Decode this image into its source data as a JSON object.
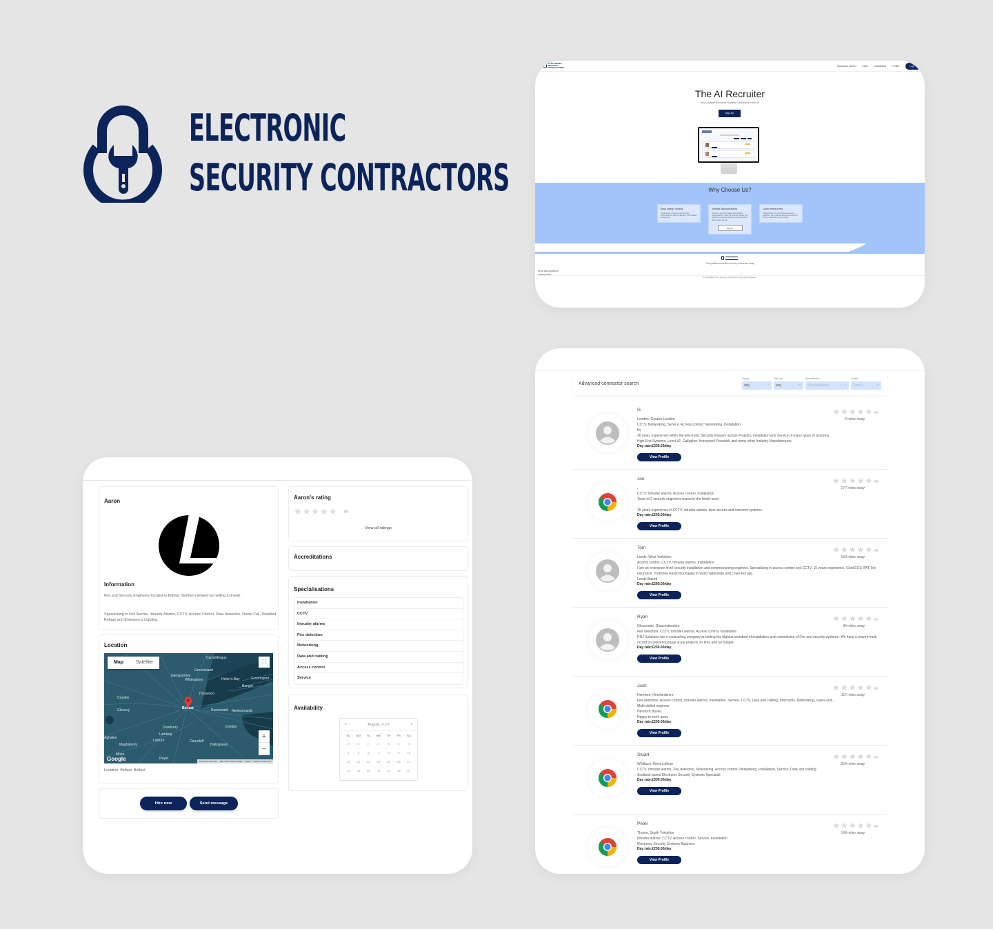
{
  "brand": {
    "line1": "ELECTRONIC",
    "line2": "SECURITY CONTRACTORS",
    "color": "#0c2459"
  },
  "landing": {
    "nav": {
      "logo_text": "ELECTRONIC SECURITY CONTRACTORS",
      "links": [
        "Contractor search",
        "Inbox",
        "Dashboard",
        "Profile"
      ],
      "login_label": "Log"
    },
    "hero": {
      "title": "The AI Recruiter",
      "subtitle": "Find Qualified Electronic Security Contractors in the UK",
      "cta": "Sign Up"
    },
    "why": {
      "title": "Why Choose Us?",
      "cards": [
        {
          "title": "Easy Hiring Process",
          "desc": "Streamlined process to find and hire subcontractors quickly based on your location preferences."
        },
        {
          "title": "Verified Subcontractors",
          "desc": "Access to a pool of vetted and qualified subcontractors. View the reviews, ratings and reviews of subcontractors so you can pick the right one for the job.",
          "button": "Sign up"
        },
        {
          "title": "Lower Hiring Fees",
          "desc": "Cheaper than the expensive recruitment agencies. Pay a flat fee and get a contractor sooner suited for the job at hand."
        }
      ]
    },
    "footer": {
      "tagline": "Find qualified electronic security contractors today",
      "links": [
        "terms and conditions",
        "privacy policy"
      ],
      "copyright": "© 2024 Electronic Security Contractors. All rights reserved."
    },
    "accent": "#a3c4fb"
  },
  "search": {
    "title": "Advanced contractor search",
    "filters": [
      {
        "label": "Rating",
        "value": "any",
        "placeholder": false
      },
      {
        "label": "Day rate",
        "value": "any",
        "placeholder": false
      },
      {
        "label": "Specialisation",
        "value": "Specialisation",
        "placeholder": true
      },
      {
        "label": "SortBy",
        "value": "SortBy",
        "placeholder": true
      }
    ],
    "view_profile_label": "View Profile",
    "results": [
      {
        "name": "G",
        "avatar": "default-user",
        "rating_count": "(0)",
        "distance": "0 miles away",
        "lines": [
          "London, Greater London",
          "CCTV, Networking, Service, Access control, Networking, Installation",
          "Hi,",
          "36 years experience within the Electronic Security Industry across Projects, Installation and Service of many types of Systems.",
          "High End Systems, Lenel s2, Gallagher, Honeywell Prowatch and many other Industry Manufacturers."
        ],
        "day_rate": "Day rate:£330.00/day"
      },
      {
        "name": "Joe",
        "avatar": "chrome",
        "rating_count": "(0)",
        "distance": "177 miles away",
        "lines": [
          ".",
          "CCTV, Intruder alarms, Access control, Installation",
          "Team of 2 security engineers based in the North west.",
          "",
          "15 years experience in CCTV, intruder alarms, door access and intercom systems."
        ],
        "day_rate": "Day rate:£250.00/day"
      },
      {
        "name": "Tom",
        "avatar": "default-user",
        "rating_count": "(0)",
        "distance": "169 miles away",
        "lines": [
          "Leeds, West Yorkshire",
          "Access control, CCTV, Intruder alarms, Installation",
          "I am an enterprise level security installation and commissioning engineer. Specialising in access control and CCTV. 15 years experience. Gold ECS IPAF 5m insurance. Yorkshire based but happy to work nationwide and cover Europe.",
          "Leeds Based"
        ],
        "day_rate": "Day rate:£260.00/day"
      },
      {
        "name": "Ryan",
        "avatar": "default-user",
        "rating_count": "(0)",
        "distance": "94 miles away",
        "lines": [
          "Gloucester, Gloucestershire",
          "Fire detection, CCTV, Intruder alarms, Access control, Installation",
          "RNJ Solutions are a contracting company providing the highest standard of installation and commission of Fire and security systems. We have a proven track record on delivering large scale projects on time and on budget."
        ],
        "day_rate": "Day rate:£250.00/day"
      },
      {
        "name": "Josh",
        "avatar": "chrome",
        "rating_count": "(0)",
        "distance": "117 miles away",
        "lines": [
          "Hereford, Herefordshire",
          "Fire detection, Access control, Intruder alarms, Installation, Service, CCTV, Data and cabling, Intercoms, Networking, Gates and...",
          "Multi-skilled engineer",
          "Hereford Based",
          "Happy to work away"
        ],
        "day_rate": "Day rate:£260.00/day"
      },
      {
        "name": "Stuart",
        "avatar": "chrome",
        "rating_count": "(0)",
        "distance": "334 miles away",
        "lines": [
          "Whitburn, West Lothian",
          "CCTV, Intruder alarms, Fire detection, Networking, Access control, Networking, Installation, Service, Data and cabling",
          "Scotland based Electronic Security Systems Specialist"
        ],
        "day_rate": "Day rate:£330.00/day"
      },
      {
        "name": "Peter",
        "avatar": "chrome",
        "rating_count": "(0)",
        "distance": "149 miles away",
        "lines": [
          "Thorne, South Yorkshire",
          "Intruder alarms, CCTV, Access control, Service, Installation",
          "Electronic Security Systems Business"
        ],
        "day_rate": "Day rate:£250.00/day"
      }
    ]
  },
  "profile": {
    "name": "Aaron",
    "info_title": "Information",
    "info_p1": "Fire and Security Engineers located in Belfast, Northern Ireland but willing to travel.",
    "info_p2": "Specialising in Fire Alarms, Intruder Alarms, CCTV, Access Control, Data Networks, Nurse Call, Disabled Refuge and Emergency Lighting.",
    "location_title": "Location",
    "map": {
      "tabs": [
        "Map",
        "Satellite"
      ],
      "active_tab": "Map",
      "pin_label": "Belfast",
      "places": [
        "Carrickfergus",
        "Greenisland",
        "Glengormley",
        "Whiteabbey",
        "Helen's Bay",
        "Groomsport",
        "Bangor",
        "Holywood",
        "Crumlin",
        "Glenavy",
        "Belfast",
        "Dundonald",
        "Newtownards",
        "Dunmurry",
        "Comber",
        "Lambeg",
        "Aghalee",
        "Lisburn",
        "Carryduff",
        "Maghaberry",
        "Ballygowan",
        "Moira",
        "Royal"
      ],
      "attribution": [
        "Keyboard shortcuts",
        "Map data ©2024 Google",
        "Terms",
        "Report a map error"
      ],
      "google": "Google"
    },
    "location_text": "Location: Belfast, Belfast",
    "hire_label": "Hire now",
    "message_label": "Send message",
    "rating_title": "Aaron's rating",
    "rating_value": 0,
    "rating_max": 5,
    "rating_count": "(0)",
    "view_all_ratings": "View all ratings",
    "accreditations_title": "Accreditations",
    "specialisations_title": "Specialisations",
    "specialisations": [
      "Installation",
      "CCTV",
      "Intruder alarms",
      "Fire detection",
      "Networking",
      "Data and cabling",
      "Access control",
      "Service"
    ],
    "availability_title": "Availability",
    "calendar": {
      "month": "August,",
      "year": "2024",
      "weekdays": [
        "SU",
        "MO",
        "TU",
        "WE",
        "TH",
        "FR",
        "SA"
      ],
      "weeks": [
        [
          "28",
          "29",
          "30",
          "31",
          "1",
          "2",
          "3"
        ],
        [
          "4",
          "5",
          "6",
          "7",
          "8",
          "9",
          "10"
        ],
        [
          "11",
          "12",
          "13",
          "14",
          "15",
          "16",
          "17"
        ],
        [
          "18",
          "19",
          "20",
          "21",
          "22",
          "23",
          "24"
        ]
      ]
    }
  }
}
